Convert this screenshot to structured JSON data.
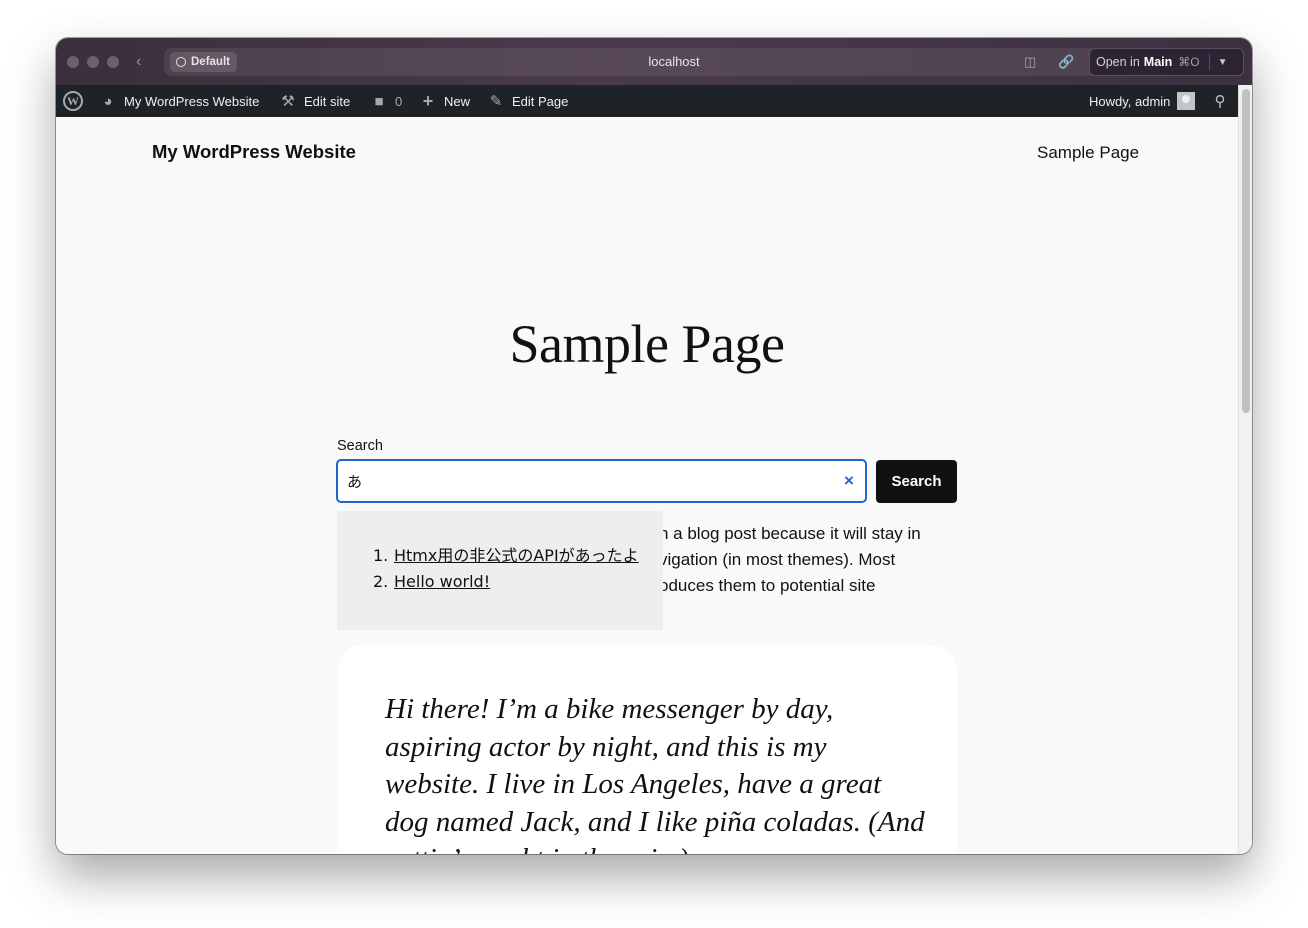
{
  "browser": {
    "profile_label": "Default",
    "url": "localhost",
    "open_in_prefix": "Open in",
    "open_in_target": "Main",
    "open_in_shortcut": "⌘O"
  },
  "adminbar": {
    "site_name": "My WordPress Website",
    "edit_site": "Edit site",
    "comments_count": "0",
    "new_label": "New",
    "edit_page": "Edit Page",
    "greeting": "Howdy, admin"
  },
  "site": {
    "title": "My WordPress Website",
    "nav_link": "Sample Page"
  },
  "page": {
    "title": "Sample Page",
    "search": {
      "label": "Search",
      "value": "あ",
      "button": "Search"
    },
    "paragraph_partial": "n a blog post because it will stay in\nvigation (in most themes). Most\noduces them to potential site",
    "suggestions": [
      {
        "number": "1.",
        "text": "Htmx用の非公式のAPIがあったよ"
      },
      {
        "number": "2.",
        "text": "Hello world!"
      }
    ],
    "quote": "Hi there! I’m a bike messenger by day, aspiring actor by night, and this is my website. I live in Los Angeles, have a great dog named Jack, and I like piña coladas. (And gettin’ caught in the rain.)"
  }
}
